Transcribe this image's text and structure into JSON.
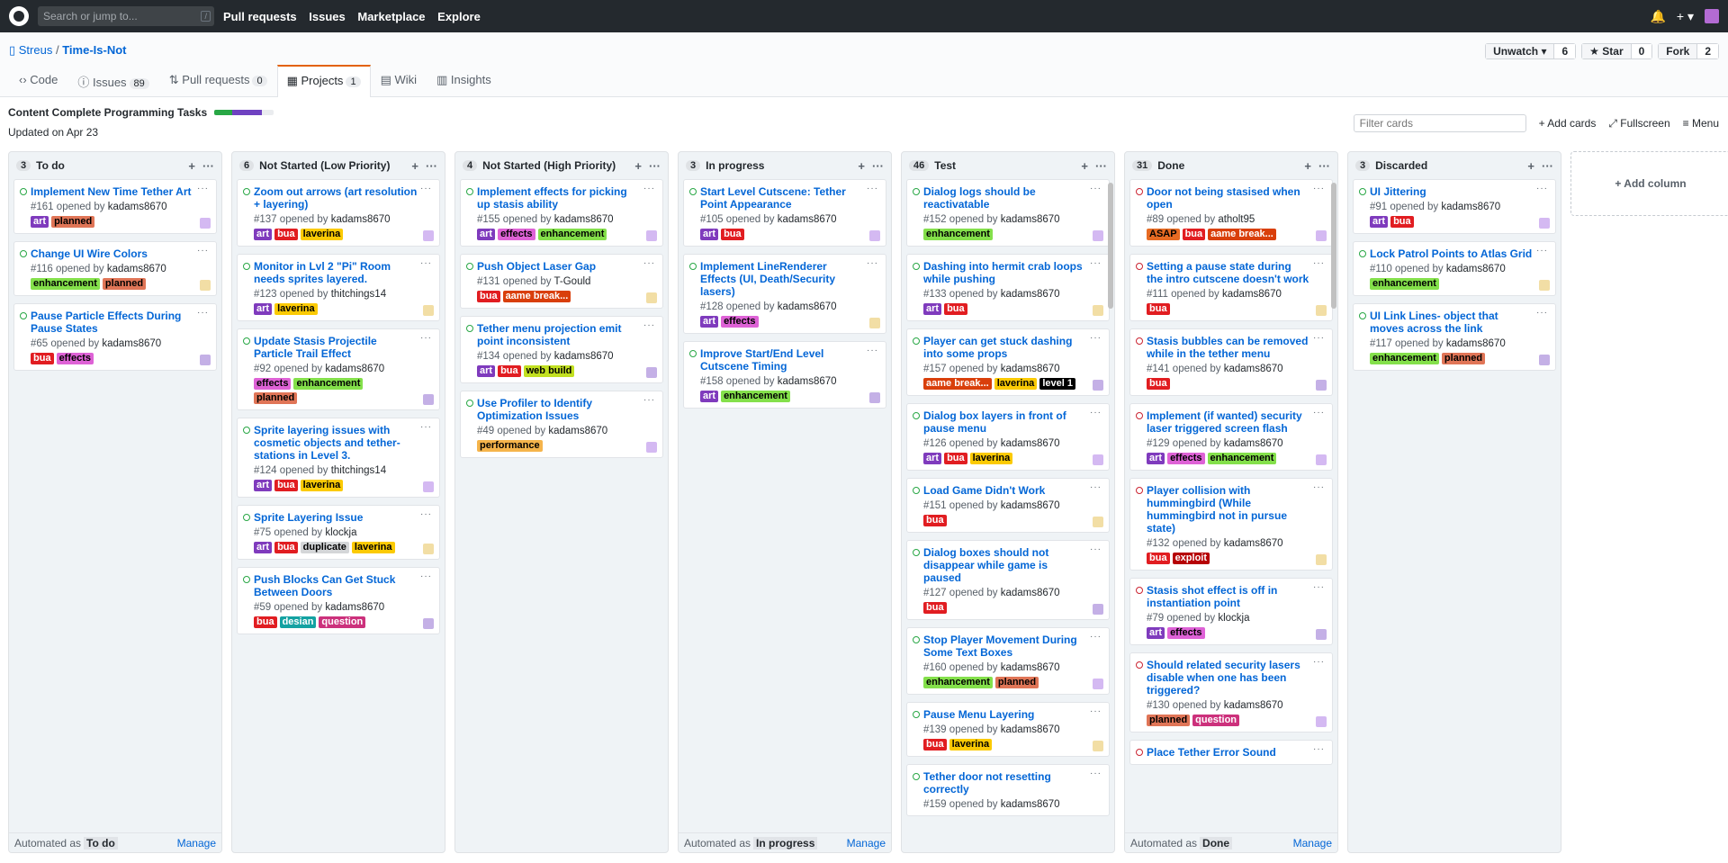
{
  "nav": {
    "search_placeholder": "Search or jump to...",
    "search_key": "/",
    "links": [
      "Pull requests",
      "Issues",
      "Marketplace",
      "Explore"
    ],
    "plus": "+ ▾"
  },
  "repo": {
    "owner": "Streus",
    "separator": "/",
    "name": "Time-Is-Not",
    "unwatch_label": "Unwatch ▾",
    "unwatch_count": "6",
    "star_label": "★ Star",
    "star_count": "0",
    "fork_label": "Fork",
    "fork_count": "2"
  },
  "tabs": [
    {
      "label": "‹› Code",
      "count": ""
    },
    {
      "label": "ⓘ Issues",
      "count": "89"
    },
    {
      "label": "⇅ Pull requests",
      "count": "0"
    },
    {
      "label": "▦ Projects",
      "count": "1"
    },
    {
      "label": "▤ Wiki",
      "count": ""
    },
    {
      "label": "▥ Insights",
      "count": ""
    }
  ],
  "project": {
    "title": "Content Complete Programming Tasks",
    "updated": "Updated on Apr 23",
    "progress": {
      "done": 0.3,
      "in_progress": 0.5
    },
    "filter_placeholder": "Filter cards",
    "add_cards": "+ Add cards",
    "fullscreen": "⤢ Fullscreen",
    "menu": "≡ Menu",
    "add_column": "+ Add column"
  },
  "columns": [
    {
      "name": "To do",
      "count": "3",
      "automated": "Automated as",
      "automated_as": "To do",
      "manage": "Manage",
      "cards": [
        {
          "title": "Implement New Time Tether Art",
          "num": "#161",
          "opened": "opened by",
          "user": "kadams8670",
          "labels": [
            "art",
            "planned"
          ],
          "state": "open"
        },
        {
          "title": "Change UI Wire Colors",
          "num": "#116",
          "opened": "opened by",
          "user": "kadams8670",
          "labels": [
            "enhancement",
            "planned"
          ],
          "state": "open"
        },
        {
          "title": "Pause Particle Effects During Pause States",
          "num": "#65",
          "opened": "opened by",
          "user": "kadams8670",
          "labels": [
            "bug",
            "effects"
          ],
          "state": "open"
        }
      ]
    },
    {
      "name": "Not Started (Low Priority)",
      "count": "6",
      "automated": "",
      "automated_as": "",
      "manage": "",
      "cards": [
        {
          "title": "Zoom out arrows (art resolution + layering)",
          "num": "#137",
          "opened": "opened by",
          "user": "kadams8670",
          "labels": [
            "art",
            "bug",
            "layering"
          ],
          "state": "open"
        },
        {
          "title": "Monitor in Lvl 2 \"Pi\" Room needs sprites layered.",
          "num": "#123",
          "opened": "opened by",
          "user": "thitchings14",
          "labels": [
            "art",
            "layering"
          ],
          "state": "open"
        },
        {
          "title": "Update Stasis Projectile Particle Trail Effect",
          "num": "#92",
          "opened": "opened by",
          "user": "kadams8670",
          "labels": [
            "effects",
            "enhancement",
            "planned"
          ],
          "state": "open"
        },
        {
          "title": "Sprite layering issues with cosmetic objects and tether-stations in Level 3.",
          "num": "#124",
          "opened": "opened by",
          "user": "thitchings14",
          "labels": [
            "art",
            "bug",
            "layering"
          ],
          "state": "open"
        },
        {
          "title": "Sprite Layering Issue",
          "num": "#75",
          "opened": "opened by",
          "user": "klockja",
          "labels": [
            "art",
            "bug",
            "duplicate",
            "layering"
          ],
          "state": "open"
        },
        {
          "title": "Push Blocks Can Get Stuck Between Doors",
          "num": "#59",
          "opened": "opened by",
          "user": "kadams8670",
          "labels": [
            "bug",
            "design",
            "question"
          ],
          "state": "open"
        }
      ]
    },
    {
      "name": "Not Started (High Priority)",
      "count": "4",
      "automated": "",
      "automated_as": "",
      "manage": "",
      "cards": [
        {
          "title": "Implement effects for picking up stasis ability",
          "num": "#155",
          "opened": "opened by",
          "user": "kadams8670",
          "labels": [
            "art",
            "effects",
            "enhancement"
          ],
          "state": "open"
        },
        {
          "title": "Push Object Laser Gap",
          "num": "#131",
          "opened": "opened by",
          "user": "T-Gould",
          "labels": [
            "bug",
            "game break..."
          ],
          "state": "open"
        },
        {
          "title": "Tether menu projection emit point inconsistent",
          "num": "#134",
          "opened": "opened by",
          "user": "kadams8670",
          "labels": [
            "art",
            "bug",
            "web build"
          ],
          "state": "open"
        },
        {
          "title": "Use Profiler to Identify Optimization Issues",
          "num": "#49",
          "opened": "opened by",
          "user": "kadams8670",
          "labels": [
            "performance"
          ],
          "state": "open"
        }
      ]
    },
    {
      "name": "In progress",
      "count": "3",
      "automated": "Automated as",
      "automated_as": "In progress",
      "manage": "Manage",
      "cards": [
        {
          "title": "Start Level Cutscene: Tether Point Appearance",
          "num": "#105",
          "opened": "opened by",
          "user": "kadams8670",
          "labels": [
            "art",
            "bug"
          ],
          "state": "open"
        },
        {
          "title": "Implement LineRenderer Effects (UI, Death/Security lasers)",
          "num": "#128",
          "opened": "opened by",
          "user": "kadams8670",
          "labels": [
            "art",
            "effects"
          ],
          "state": "open"
        },
        {
          "title": "Improve Start/End Level Cutscene Timing",
          "num": "#158",
          "opened": "opened by",
          "user": "kadams8670",
          "labels": [
            "art",
            "enhancement"
          ],
          "state": "open"
        }
      ]
    },
    {
      "name": "Test",
      "count": "46",
      "automated": "",
      "automated_as": "",
      "manage": "",
      "cards": [
        {
          "title": "Dialog logs should be reactivatable",
          "num": "#152",
          "opened": "opened by",
          "user": "kadams8670",
          "labels": [
            "enhancement"
          ],
          "state": "open"
        },
        {
          "title": "Dashing into hermit crab loops while pushing",
          "num": "#133",
          "opened": "opened by",
          "user": "kadams8670",
          "labels": [
            "art",
            "bug"
          ],
          "state": "open"
        },
        {
          "title": "Player can get stuck dashing into some props",
          "num": "#157",
          "opened": "opened by",
          "user": "kadams8670",
          "labels": [
            "game break...",
            "layering",
            "level 1"
          ],
          "state": "open"
        },
        {
          "title": "Dialog box layers in front of pause menu",
          "num": "#126",
          "opened": "opened by",
          "user": "kadams8670",
          "labels": [
            "art",
            "bug",
            "layering"
          ],
          "state": "open"
        },
        {
          "title": "Load Game Didn't Work",
          "num": "#151",
          "opened": "opened by",
          "user": "kadams8670",
          "labels": [
            "bug"
          ],
          "state": "open"
        },
        {
          "title": "Dialog boxes should not disappear while game is paused",
          "num": "#127",
          "opened": "opened by",
          "user": "kadams8670",
          "labels": [
            "bug"
          ],
          "state": "open"
        },
        {
          "title": "Stop Player Movement During Some Text Boxes",
          "num": "#160",
          "opened": "opened by",
          "user": "kadams8670",
          "labels": [
            "enhancement",
            "planned"
          ],
          "state": "open"
        },
        {
          "title": "Pause Menu Layering",
          "num": "#139",
          "opened": "opened by",
          "user": "kadams8670",
          "labels": [
            "bug",
            "layering"
          ],
          "state": "open"
        },
        {
          "title": "Tether door not resetting correctly",
          "num": "#159",
          "opened": "opened by",
          "user": "kadams8670",
          "labels": [],
          "state": "open"
        }
      ]
    },
    {
      "name": "Done",
      "count": "31",
      "automated": "Automated as",
      "automated_as": "Done",
      "manage": "Manage",
      "cards": [
        {
          "title": "Door not being stasised when open",
          "num": "#89",
          "opened": "opened by",
          "user": "atholt95",
          "labels": [
            "ASAP",
            "bug",
            "game break..."
          ],
          "state": "closed"
        },
        {
          "title": "Setting a pause state during the intro cutscene doesn't work",
          "num": "#111",
          "opened": "opened by",
          "user": "kadams8670",
          "labels": [
            "bug"
          ],
          "state": "closed"
        },
        {
          "title": "Stasis bubbles can be removed while in the tether menu",
          "num": "#141",
          "opened": "opened by",
          "user": "kadams8670",
          "labels": [
            "bug"
          ],
          "state": "closed"
        },
        {
          "title": "Implement (if wanted) security laser triggered screen flash",
          "num": "#129",
          "opened": "opened by",
          "user": "kadams8670",
          "labels": [
            "art",
            "effects",
            "enhancement"
          ],
          "state": "closed"
        },
        {
          "title": "Player collision with hummingbird (While hummingbird not in pursue state)",
          "num": "#132",
          "opened": "opened by",
          "user": "kadams8670",
          "labels": [
            "bug",
            "exploit"
          ],
          "state": "closed"
        },
        {
          "title": "Stasis shot effect is off in instantiation point",
          "num": "#79",
          "opened": "opened by",
          "user": "klockja",
          "labels": [
            "art",
            "effects"
          ],
          "state": "closed"
        },
        {
          "title": "Should related security lasers disable when one has been triggered?",
          "num": "#130",
          "opened": "opened by",
          "user": "kadams8670",
          "labels": [
            "planned",
            "question"
          ],
          "state": "closed"
        },
        {
          "title": "Place Tether Error Sound",
          "num": "",
          "opened": "",
          "user": "",
          "labels": [],
          "state": "closed"
        }
      ]
    },
    {
      "name": "Discarded",
      "count": "3",
      "automated": "",
      "automated_as": "",
      "manage": "",
      "cards": [
        {
          "title": "UI Jittering",
          "num": "#91",
          "opened": "opened by",
          "user": "kadams8670",
          "labels": [
            "art",
            "bug"
          ],
          "state": "open"
        },
        {
          "title": "Lock Patrol Points to Atlas Grid",
          "num": "#110",
          "opened": "opened by",
          "user": "kadams8670",
          "labels": [
            "enhancement"
          ],
          "state": "open"
        },
        {
          "title": "UI Link Lines- object that moves across the link",
          "num": "#117",
          "opened": "opened by",
          "user": "kadams8670",
          "labels": [
            "enhancement",
            "planned"
          ],
          "state": "open"
        }
      ]
    }
  ]
}
